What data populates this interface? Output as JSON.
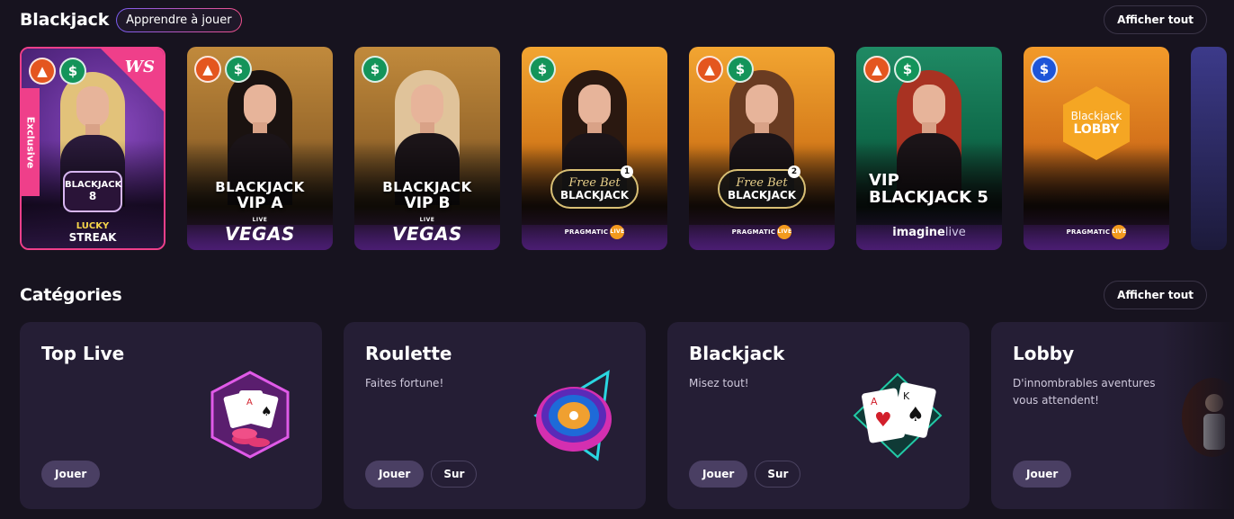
{
  "blackjack_section": {
    "title": "Blackjack",
    "learn_label": "Apprendre à jouer",
    "show_all_label": "Afficher tout",
    "games": [
      {
        "id": "g1",
        "badges": [
          "fire-icon",
          "dollar-icon"
        ],
        "exclusive_label": "Exclusive",
        "studio_mark": "WS",
        "logo_line1": "BLACKJACK",
        "logo_line2": "8",
        "provider": "LUCKY STREAK",
        "provider_l1": "LUCKY",
        "provider_l2": "STREAK"
      },
      {
        "id": "g2",
        "badges": [
          "fire-icon",
          "dollar-icon"
        ],
        "logo_line1": "BLACKJACK",
        "logo_line2": "VIP A",
        "provider_small": "LIVE",
        "provider": "VEGAS"
      },
      {
        "id": "g3",
        "badges": [
          "dollar-icon"
        ],
        "logo_line1": "BLACKJACK",
        "logo_line2": "VIP B",
        "provider_small": "LIVE",
        "provider": "VEGAS"
      },
      {
        "id": "g4",
        "badges": [
          "dollar-icon"
        ],
        "logo_line1": "Free Bet",
        "logo_line2": "BLACKJACK",
        "number": "1",
        "provider": "PRAGMATIC",
        "provider_tag": "LIVE"
      },
      {
        "id": "g5",
        "badges": [
          "fire-icon",
          "dollar-icon"
        ],
        "logo_line1": "Free Bet",
        "logo_line2": "BLACKJACK",
        "number": "2",
        "provider": "PRAGMATIC",
        "provider_tag": "LIVE"
      },
      {
        "id": "g6",
        "badges": [
          "fire-icon",
          "dollar-icon"
        ],
        "logo_line1": "VIP",
        "logo_line2": "BLACKJACK 5",
        "provider": "imagine",
        "provider_suffix": "live"
      },
      {
        "id": "g7",
        "badges": [
          "sync-dollar-icon"
        ],
        "logo_line1": "Blackjack",
        "logo_line2": "LOBBY",
        "provider": "PRAGMATIC",
        "provider_tag": "LIVE"
      }
    ]
  },
  "categories_section": {
    "title": "Catégories",
    "show_all_label": "Afficher tout",
    "cards": [
      {
        "title": "Top Live",
        "subtitle": "",
        "play_label": "Jouer"
      },
      {
        "title": "Roulette",
        "subtitle": "Faites fortune!",
        "play_label": "Jouer",
        "more_label": "Sur"
      },
      {
        "title": "Blackjack",
        "subtitle": "Misez tout!",
        "play_label": "Jouer",
        "more_label": "Sur"
      },
      {
        "title": "Lobby",
        "subtitle": "D'innombrables aventures vous attendent!",
        "play_label": "Jouer"
      }
    ]
  },
  "colors": {
    "background": "#17131f",
    "card": "#251e35",
    "accent_pink": "#ef3f8a",
    "fire_badge": "#e4561f",
    "money_badge": "#14945a"
  }
}
